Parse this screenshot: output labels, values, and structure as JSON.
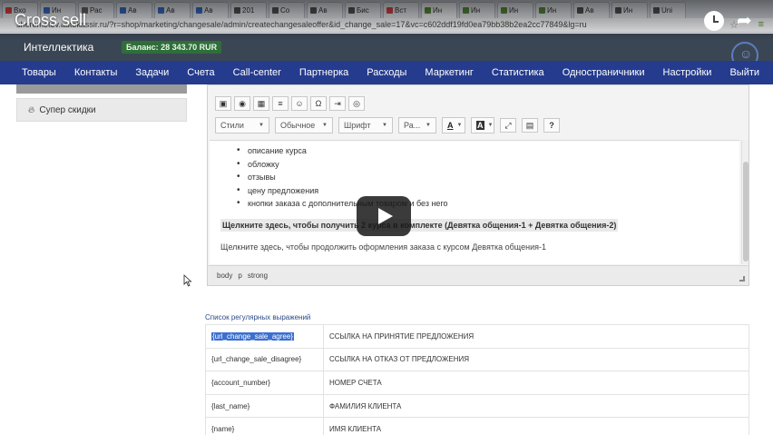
{
  "video": {
    "title": "Cross sell"
  },
  "browser": {
    "url": "sheremetev.autokassir.ru/?r=shop/marketing/changesale/admin/createchangesaleoffer&id_change_sale=17&vc=c602ddf19fd0ea79bb38b2ea2cc77849&lg=ru",
    "tabs": [
      {
        "label": "Вхо",
        "color": "#d44"
      },
      {
        "label": "Ин",
        "color": "#3a6fd0"
      },
      {
        "label": "Рас",
        "color": "#666"
      },
      {
        "label": "Ав",
        "color": "#3a6fd0"
      },
      {
        "label": "Ав",
        "color": "#3a6fd0"
      },
      {
        "label": "Ав",
        "color": "#3a6fd0"
      },
      {
        "label": "201",
        "color": "#555"
      },
      {
        "label": "Со",
        "color": "#555"
      },
      {
        "label": "Ав",
        "color": "#555"
      },
      {
        "label": "Бис",
        "color": "#555"
      },
      {
        "label": "Вст",
        "color": "#d44"
      },
      {
        "label": "Ин",
        "color": "#5a8e3a"
      },
      {
        "label": "Ин",
        "color": "#5a8e3a"
      },
      {
        "label": "Ин",
        "color": "#5a8e3a"
      },
      {
        "label": "Ин",
        "color": "#5a8e3a"
      },
      {
        "label": "Ав",
        "color": "#555"
      },
      {
        "label": "Ин",
        "color": "#555"
      },
      {
        "label": "Uni",
        "color": "#555"
      }
    ]
  },
  "app": {
    "brand": "Интеллектика",
    "balance": "Баланс: 28 343.70 RUR",
    "nav": [
      "Товары",
      "Контакты",
      "Задачи",
      "Счета",
      "Call-center",
      "Партнерка",
      "Расходы",
      "Маркетинг",
      "Статистика",
      "Одностраничники",
      "Настройки",
      "Выйти"
    ]
  },
  "sidebar": {
    "item_label": "Супер скидки"
  },
  "editor": {
    "toolbar_row2": [
      "▣",
      "◉",
      "▦",
      "≡",
      "☺",
      "Ω",
      "⇥",
      "◎"
    ],
    "combos": {
      "styles": "Стили",
      "format": "Обычное",
      "font": "Шрифт",
      "size": "Ра..."
    },
    "color_a": "A",
    "bg_a": "A",
    "bullets": [
      "описание курса",
      "обложку",
      "отзывы",
      "цену предложения",
      "кнопки заказа с дополнительным товаром и без него"
    ],
    "bold_line": "Щелкните здесь, чтобы получить 2 курса в комплекте (Девятка общения-1 + Девятка общения-2)",
    "plain_line": "Щелкните здесь, чтобы продолжить оформления заказа с курсом Девятка общения-1",
    "status_path": [
      "body",
      "p",
      "strong"
    ]
  },
  "regex": {
    "title": "Список регулярных выражений",
    "rows": [
      {
        "key": "{url_change_sale_agree}",
        "value": "ССЫЛКА НА ПРИНЯТИЕ ПРЕДЛОЖЕНИЯ"
      },
      {
        "key": "{url_change_sale_disagree}",
        "value": "ССЫЛКА НА ОТКАЗ ОТ ПРЕДЛОЖЕНИЯ"
      },
      {
        "key": "{account_number}",
        "value": "НОМЕР СЧЕТА"
      },
      {
        "key": "{last_name}",
        "value": "ФАМИЛИЯ КЛИЕНТА"
      },
      {
        "key": "{name}",
        "value": "ИМЯ КЛИЕНТА"
      }
    ]
  }
}
